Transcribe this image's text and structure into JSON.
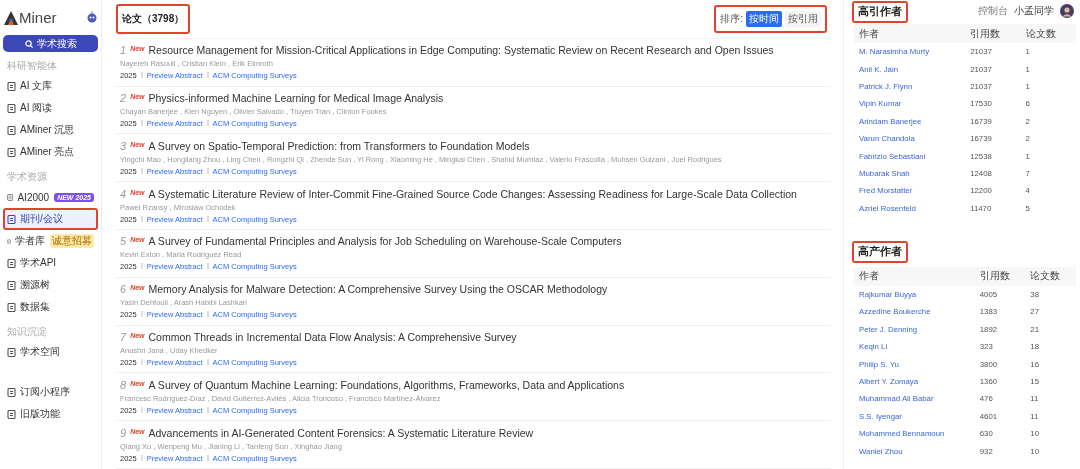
{
  "sidebar": {
    "logo": "Miner",
    "search_button": "学术搜索",
    "sections": [
      {
        "label": "科研智能体",
        "items": [
          {
            "label": "AI 文库",
            "selected": false
          },
          {
            "label": "AI 阅读",
            "selected": false
          },
          {
            "label": "AMiner 沉思",
            "selected": false
          },
          {
            "label": "AMiner 亮点",
            "selected": false
          }
        ]
      },
      {
        "label": "学术资源",
        "items": [
          {
            "label": "AI2000",
            "selected": false,
            "badge": {
              "text": "NEW 2025",
              "color": "#7b4ff0"
            }
          },
          {
            "label": "期刊/会议",
            "selected": true,
            "annotated": true
          },
          {
            "label": "学者库",
            "selected": false,
            "badge": {
              "text": "诚意招募",
              "color": "#fde9a8"
            }
          },
          {
            "label": "学术API",
            "selected": false
          },
          {
            "label": "溯源树",
            "selected": false
          },
          {
            "label": "数据集",
            "selected": false
          }
        ]
      },
      {
        "label": "知识沉淀",
        "items": [
          {
            "label": "学术空间",
            "selected": false
          }
        ]
      },
      {
        "items": [
          {
            "label": "订阅小程序",
            "selected": false
          },
          {
            "label": "旧版功能",
            "selected": false
          }
        ]
      }
    ]
  },
  "papers": {
    "title": "论文（3798）",
    "annotated": true,
    "sort": {
      "label": "排序:",
      "annotated": true,
      "options": [
        {
          "label": "按时间",
          "selected": true
        },
        {
          "label": "按引用",
          "selected": false
        }
      ]
    },
    "items": [
      {
        "index": "1",
        "badge": "New",
        "title": "Resource Management for Mission-Critical Applications in Edge Computing: Systematic Review on Recent Research and Open Issues",
        "authors": "Nayereh Rasouli , Cristian Klein , Erik Elmroth",
        "year": "2025",
        "link": "Preview Abstract",
        "venue": "ACM Computing Surveys"
      },
      {
        "index": "2",
        "badge": "New",
        "title": "Physics-informed Machine Learning for Medical Image Analysis",
        "authors": "Chayan Banerjee , Kien Nguyen , Olivier Salvado , Truyen Tran , Clinton Fookes",
        "year": "2025",
        "link": "Preview Abstract",
        "venue": "ACM Computing Surveys"
      },
      {
        "index": "3",
        "badge": "New",
        "title": "A Survey on Spatio-Temporal Prediction: from Transformers to Foundation Models",
        "authors": "Yingchi Mao , Hongliang Zhou , Ling Chen , Rongzhi Qi , Zhende Sun , Yi Rong , Xiaoming He , Mingkai Chen , Shahid Mumtaz , Valerio Frascolla , Mohsen Guizani , Joel Rodrigues",
        "year": "2025",
        "link": "Preview Abstract",
        "venue": "ACM Computing Surveys"
      },
      {
        "index": "4",
        "badge": "New",
        "title": "A Systematic Literature Review of Inter-Commit Fine-Grained Source Code Changes: Assessing Readiness for Large-Scale Data Collection",
        "authors": "Paweł Rzansy , Mirosław Ochodek",
        "year": "2025",
        "link": "Preview Abstract",
        "venue": "ACM Computing Surveys"
      },
      {
        "index": "5",
        "badge": "New",
        "title": "A Survey of Fundamental Principles and Analysis for Job Scheduling on Warehouse-Scale Computers",
        "authors": "Kevin Exton , Maria Rodriguez Read",
        "year": "2025",
        "link": "Preview Abstract",
        "venue": "ACM Computing Surveys"
      },
      {
        "index": "6",
        "badge": "New",
        "title": "Memory Analysis for Malware Detection: A Comprehensive Survey Using the OSCAR Methodology",
        "authors": "Yasin Dehfouli , Arash Habibi Lashkari",
        "year": "2025",
        "link": "Preview Abstract",
        "venue": "ACM Computing Surveys"
      },
      {
        "index": "7",
        "badge": "New",
        "title": "Common Threads in Incremental Data Flow Analysis: A Comprehensive Survey",
        "authors": "Anushri Jana , Uday Khedker",
        "year": "2025",
        "link": "Preview Abstract",
        "venue": "ACM Computing Surveys"
      },
      {
        "index": "8",
        "badge": "New",
        "title": "A Survey of Quantum Machine Learning: Foundations, Algorithms, Frameworks, Data and Applications",
        "authors": "Francesc Rodríguez-Díaz , David Gutiérrez-Avilés , Alicia Troncoso , Francisco Martínez-Álvarez",
        "year": "2025",
        "link": "Preview Abstract",
        "venue": "ACM Computing Surveys"
      },
      {
        "index": "9",
        "badge": "New",
        "title": "Advancements in AI-Generated Content Forensics: A Systematic Literature Review",
        "authors": "Qiang Xu , Wenpeng Mu , Jianing Li , Tanfeng Sun , Xinghao Jiang",
        "year": "2025",
        "link": "Preview Abstract",
        "venue": "ACM Computing Surveys"
      }
    ]
  },
  "header": {
    "console": "控制台",
    "user": "小孟同学"
  },
  "author_tables": [
    {
      "title": "高引作者",
      "annotated": true,
      "columns": [
        "作者",
        "引用数",
        "论文数"
      ],
      "rows": [
        [
          "M. Narasimha Murty",
          "21037",
          "1"
        ],
        [
          "Anil K. Jain",
          "21037",
          "1"
        ],
        [
          "Patrick J. Flynn",
          "21037",
          "1"
        ],
        [
          "Vipin Kumar",
          "17530",
          "6"
        ],
        [
          "Arindam Banerjee",
          "16739",
          "2"
        ],
        [
          "Varun Chandola",
          "16739",
          "2"
        ],
        [
          "Fabrizio Sebastiani",
          "12538",
          "1"
        ],
        [
          "Mubarak Shah",
          "12408",
          "7"
        ],
        [
          "Fred Morstatter",
          "12200",
          "4"
        ],
        [
          "Azriel Rosenfeld",
          "11470",
          "5"
        ]
      ]
    },
    {
      "title": "高产作者",
      "annotated": true,
      "columns": [
        "作者",
        "引用数",
        "论文数"
      ],
      "rows": [
        [
          "Rajkumar Buyya",
          "4005",
          "38"
        ],
        [
          "Azzedine Boukerche",
          "1383",
          "27"
        ],
        [
          "Peter J. Denning",
          "1892",
          "21"
        ],
        [
          "Keqin Li",
          "323",
          "18"
        ],
        [
          "Philip S. Yu",
          "3800",
          "16"
        ],
        [
          "Albert Y. Zomaya",
          "1360",
          "15"
        ],
        [
          "Muhammad Ali Babar",
          "476",
          "11"
        ],
        [
          "S.S. Iyengar",
          "4601",
          "11"
        ],
        [
          "Mohammed Bennamoun",
          "630",
          "10"
        ],
        [
          "Wanlei Zhou",
          "932",
          "10"
        ]
      ]
    }
  ]
}
